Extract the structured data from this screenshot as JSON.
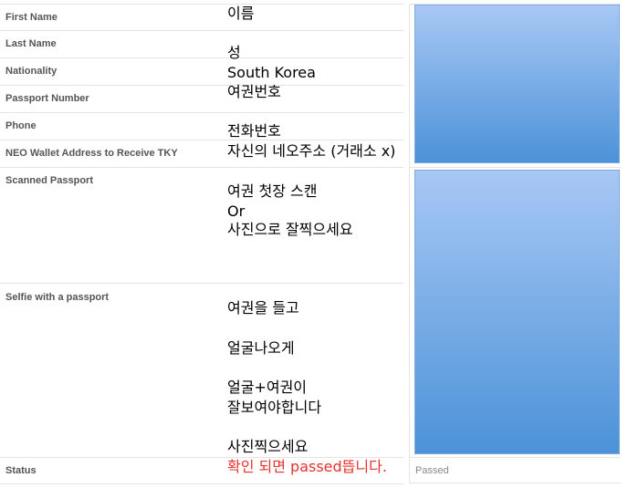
{
  "form": {
    "rows": [
      {
        "label": "First Name",
        "note": "이름"
      },
      {
        "label": "Last Name",
        "note": "성"
      },
      {
        "label": "Nationality",
        "note": "South Korea"
      },
      {
        "label": "Passport Number",
        "note": "여권번호"
      },
      {
        "label": "Phone",
        "note": "전화번호"
      },
      {
        "label": "NEO Wallet Address to Receive TKY",
        "note": "자신의 네오주소 (거래소 x)"
      },
      {
        "label": "Scanned Passport",
        "note_lines": [
          "여권 첫장 스캔",
          "Or",
          "사진으로 잘찍으세요"
        ]
      },
      {
        "label": "Selfie with a passport",
        "note_lines": [
          "여권을 들고",
          "얼굴나오게",
          "얼굴+여권이",
          "잘보여야합니다",
          "사진찍으세요"
        ]
      },
      {
        "label": "Status",
        "note": "확인 되면 passed뜹니다.",
        "value": "Passed"
      }
    ]
  },
  "colors": {
    "annotation_red": "#e8312f",
    "image_placeholder_top": "#a8c8f5",
    "image_placeholder_bottom": "#4b92d8"
  }
}
